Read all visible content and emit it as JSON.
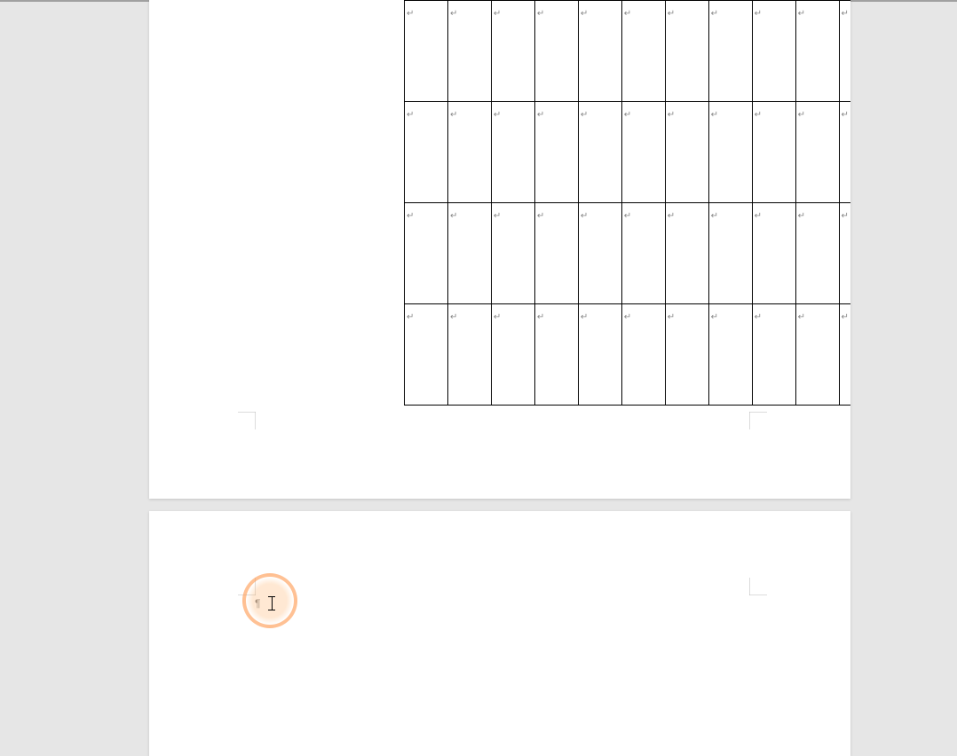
{
  "document": {
    "visible_table": {
      "rows": 4,
      "cols": 11,
      "cell_marker": "↵"
    },
    "page2_start_marker": "¶"
  },
  "ui": {
    "highlight_present": true
  }
}
